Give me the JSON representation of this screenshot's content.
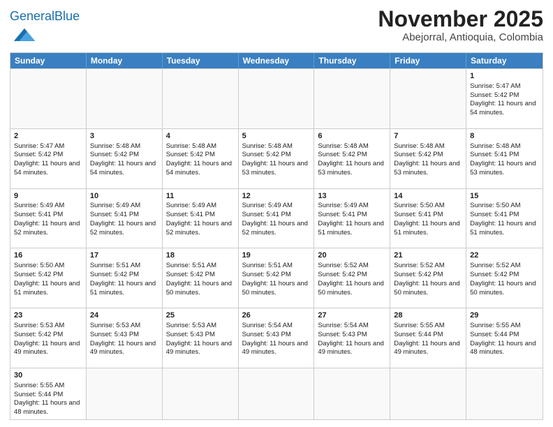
{
  "header": {
    "logo_general": "General",
    "logo_blue": "Blue",
    "month_title": "November 2025",
    "location": "Abejorral, Antioquia, Colombia"
  },
  "days_of_week": [
    "Sunday",
    "Monday",
    "Tuesday",
    "Wednesday",
    "Thursday",
    "Friday",
    "Saturday"
  ],
  "weeks": [
    [
      {
        "day": "",
        "empty": true
      },
      {
        "day": "",
        "empty": true
      },
      {
        "day": "",
        "empty": true
      },
      {
        "day": "",
        "empty": true
      },
      {
        "day": "",
        "empty": true
      },
      {
        "day": "",
        "empty": true
      },
      {
        "day": "1",
        "sunrise": "5:47 AM",
        "sunset": "5:42 PM",
        "daylight": "11 hours and 54 minutes."
      }
    ],
    [
      {
        "day": "2",
        "sunrise": "5:47 AM",
        "sunset": "5:42 PM",
        "daylight": "11 hours and 54 minutes."
      },
      {
        "day": "3",
        "sunrise": "5:48 AM",
        "sunset": "5:42 PM",
        "daylight": "11 hours and 54 minutes."
      },
      {
        "day": "4",
        "sunrise": "5:48 AM",
        "sunset": "5:42 PM",
        "daylight": "11 hours and 54 minutes."
      },
      {
        "day": "5",
        "sunrise": "5:48 AM",
        "sunset": "5:42 PM",
        "daylight": "11 hours and 53 minutes."
      },
      {
        "day": "6",
        "sunrise": "5:48 AM",
        "sunset": "5:42 PM",
        "daylight": "11 hours and 53 minutes."
      },
      {
        "day": "7",
        "sunrise": "5:48 AM",
        "sunset": "5:42 PM",
        "daylight": "11 hours and 53 minutes."
      },
      {
        "day": "8",
        "sunrise": "5:48 AM",
        "sunset": "5:41 PM",
        "daylight": "11 hours and 53 minutes."
      }
    ],
    [
      {
        "day": "9",
        "sunrise": "5:49 AM",
        "sunset": "5:41 PM",
        "daylight": "11 hours and 52 minutes."
      },
      {
        "day": "10",
        "sunrise": "5:49 AM",
        "sunset": "5:41 PM",
        "daylight": "11 hours and 52 minutes."
      },
      {
        "day": "11",
        "sunrise": "5:49 AM",
        "sunset": "5:41 PM",
        "daylight": "11 hours and 52 minutes."
      },
      {
        "day": "12",
        "sunrise": "5:49 AM",
        "sunset": "5:41 PM",
        "daylight": "11 hours and 52 minutes."
      },
      {
        "day": "13",
        "sunrise": "5:49 AM",
        "sunset": "5:41 PM",
        "daylight": "11 hours and 51 minutes."
      },
      {
        "day": "14",
        "sunrise": "5:50 AM",
        "sunset": "5:41 PM",
        "daylight": "11 hours and 51 minutes."
      },
      {
        "day": "15",
        "sunrise": "5:50 AM",
        "sunset": "5:41 PM",
        "daylight": "11 hours and 51 minutes."
      }
    ],
    [
      {
        "day": "16",
        "sunrise": "5:50 AM",
        "sunset": "5:42 PM",
        "daylight": "11 hours and 51 minutes."
      },
      {
        "day": "17",
        "sunrise": "5:51 AM",
        "sunset": "5:42 PM",
        "daylight": "11 hours and 51 minutes."
      },
      {
        "day": "18",
        "sunrise": "5:51 AM",
        "sunset": "5:42 PM",
        "daylight": "11 hours and 50 minutes."
      },
      {
        "day": "19",
        "sunrise": "5:51 AM",
        "sunset": "5:42 PM",
        "daylight": "11 hours and 50 minutes."
      },
      {
        "day": "20",
        "sunrise": "5:52 AM",
        "sunset": "5:42 PM",
        "daylight": "11 hours and 50 minutes."
      },
      {
        "day": "21",
        "sunrise": "5:52 AM",
        "sunset": "5:42 PM",
        "daylight": "11 hours and 50 minutes."
      },
      {
        "day": "22",
        "sunrise": "5:52 AM",
        "sunset": "5:42 PM",
        "daylight": "11 hours and 50 minutes."
      }
    ],
    [
      {
        "day": "23",
        "sunrise": "5:53 AM",
        "sunset": "5:42 PM",
        "daylight": "11 hours and 49 minutes."
      },
      {
        "day": "24",
        "sunrise": "5:53 AM",
        "sunset": "5:43 PM",
        "daylight": "11 hours and 49 minutes."
      },
      {
        "day": "25",
        "sunrise": "5:53 AM",
        "sunset": "5:43 PM",
        "daylight": "11 hours and 49 minutes."
      },
      {
        "day": "26",
        "sunrise": "5:54 AM",
        "sunset": "5:43 PM",
        "daylight": "11 hours and 49 minutes."
      },
      {
        "day": "27",
        "sunrise": "5:54 AM",
        "sunset": "5:43 PM",
        "daylight": "11 hours and 49 minutes."
      },
      {
        "day": "28",
        "sunrise": "5:55 AM",
        "sunset": "5:44 PM",
        "daylight": "11 hours and 49 minutes."
      },
      {
        "day": "29",
        "sunrise": "5:55 AM",
        "sunset": "5:44 PM",
        "daylight": "11 hours and 48 minutes."
      }
    ],
    [
      {
        "day": "30",
        "sunrise": "5:55 AM",
        "sunset": "5:44 PM",
        "daylight": "11 hours and 48 minutes."
      },
      {
        "day": "",
        "empty": true
      },
      {
        "day": "",
        "empty": true
      },
      {
        "day": "",
        "empty": true
      },
      {
        "day": "",
        "empty": true
      },
      {
        "day": "",
        "empty": true
      },
      {
        "day": "",
        "empty": true
      }
    ]
  ]
}
